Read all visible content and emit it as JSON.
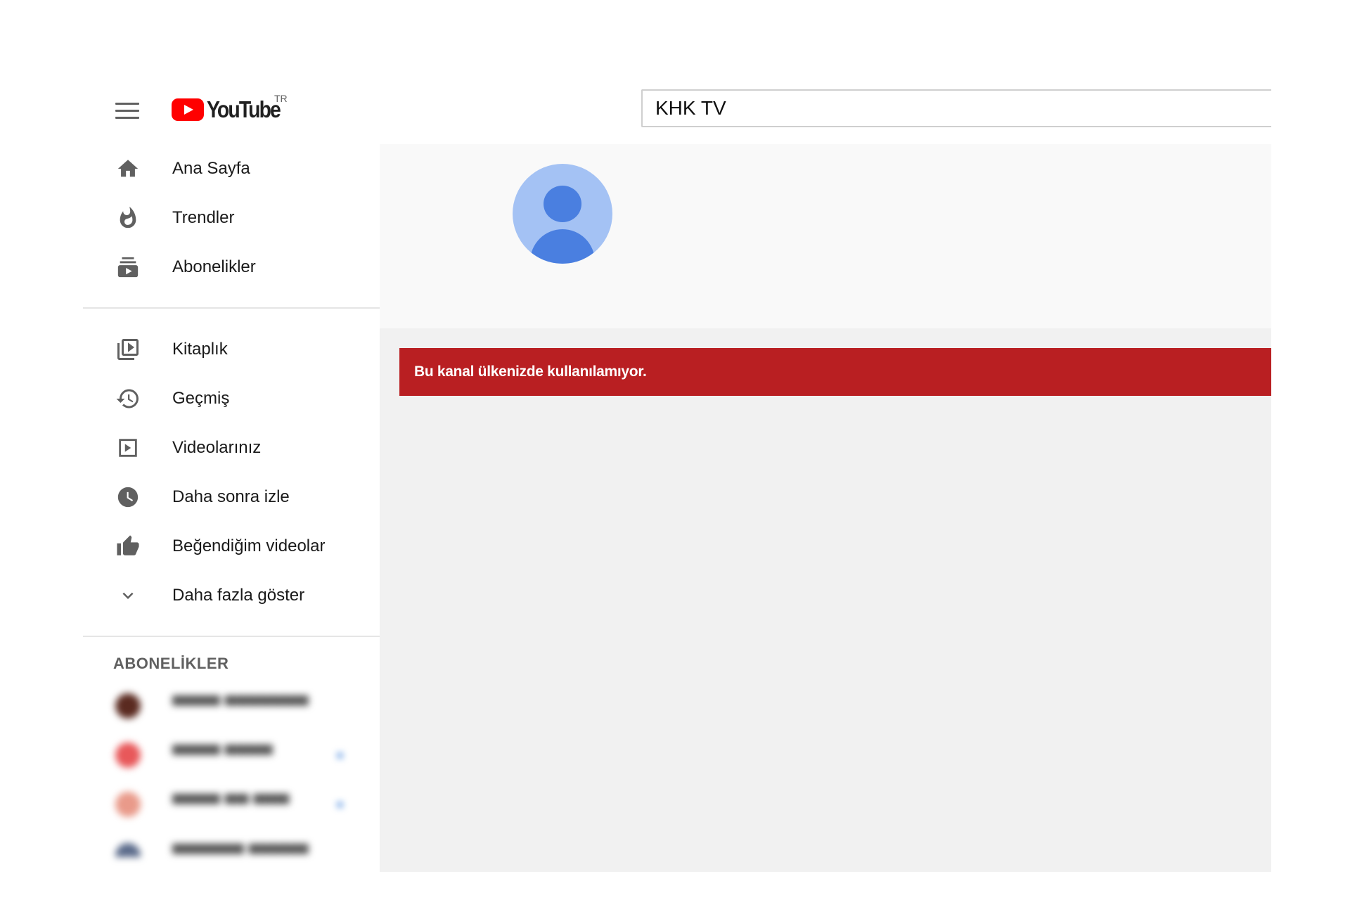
{
  "header": {
    "logo_text": "YouTube",
    "country_code": "TR",
    "search_value": "KHK TV"
  },
  "sidebar": {
    "primary": [
      {
        "label": "Ana Sayfa",
        "icon": "home-icon"
      },
      {
        "label": "Trendler",
        "icon": "flame-icon"
      },
      {
        "label": "Abonelikler",
        "icon": "subscriptions-icon"
      }
    ],
    "library": [
      {
        "label": "Kitaplık",
        "icon": "library-icon"
      },
      {
        "label": "Geçmiş",
        "icon": "history-icon"
      },
      {
        "label": "Videolarınız",
        "icon": "your-videos-icon"
      },
      {
        "label": "Daha sonra izle",
        "icon": "watch-later-icon"
      },
      {
        "label": "Beğendiğim videolar",
        "icon": "thumbs-up-icon"
      },
      {
        "label": "Daha fazla göster",
        "icon": "chevron-down-icon"
      }
    ],
    "subscriptions_title": "ABONELİKLER"
  },
  "main": {
    "alert_message": "Bu kanal ülkenizde kullanılamıyor."
  },
  "colors": {
    "brand_red": "#ff0000",
    "alert_red": "#b91f22",
    "avatar_light": "#a4c2f4",
    "avatar_dark": "#4a7fe0",
    "new_dot": "#065fd4"
  }
}
